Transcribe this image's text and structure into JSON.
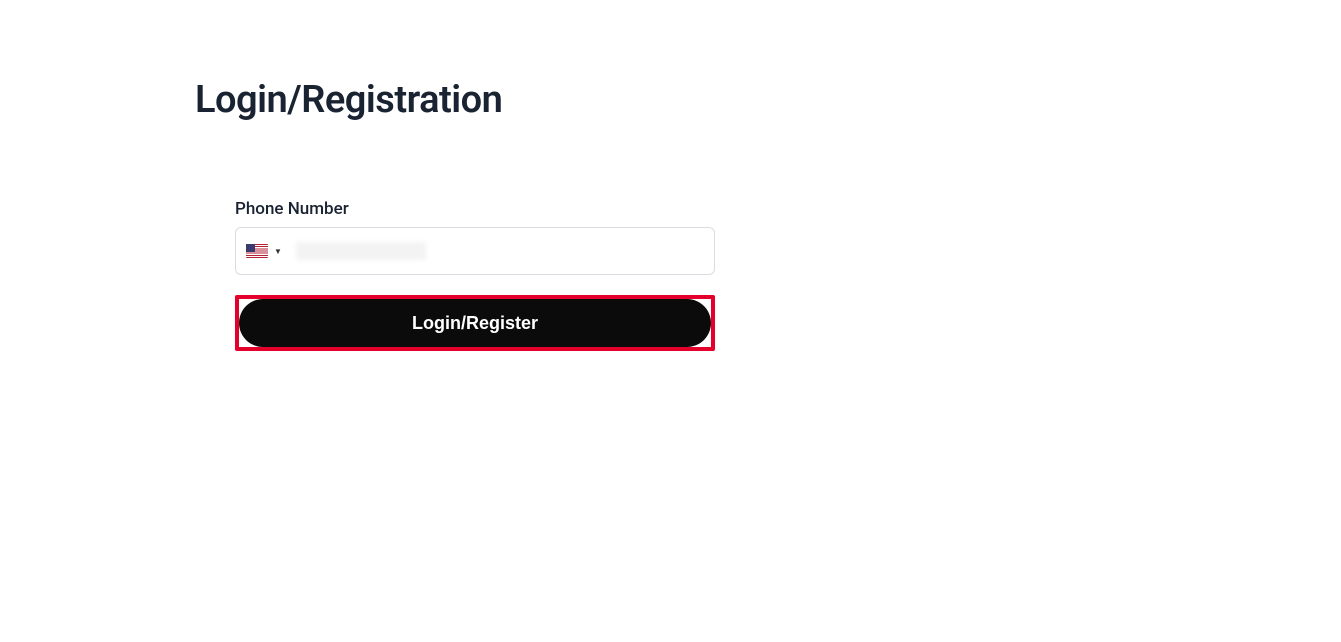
{
  "page": {
    "title": "Login/Registration"
  },
  "form": {
    "phone": {
      "label": "Phone Number",
      "value": "",
      "placeholder": "",
      "country_code": "us",
      "country_flag": "flag-us"
    },
    "submit_label": "Login/Register"
  },
  "highlight": {
    "color": "#e4002b"
  }
}
